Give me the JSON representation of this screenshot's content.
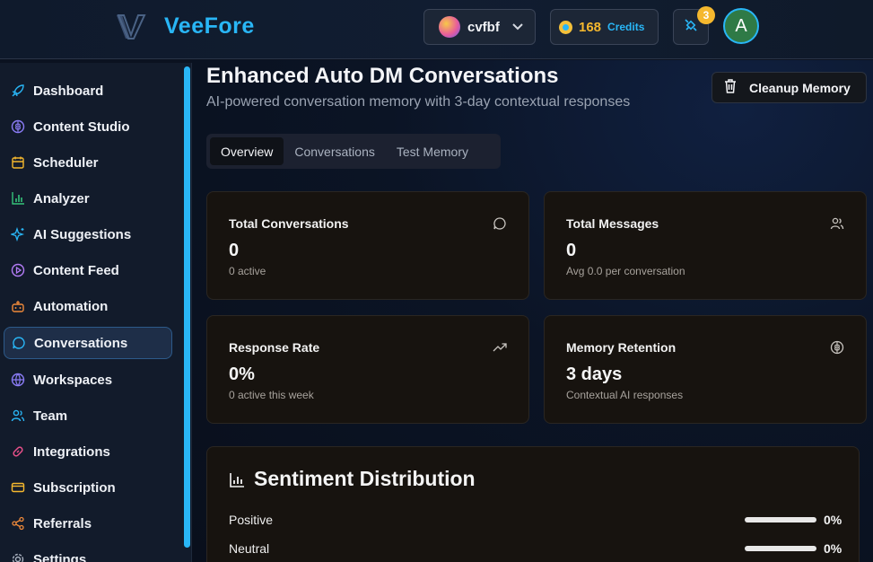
{
  "brand": {
    "name": "VeeFore",
    "accent": "#29b6f6"
  },
  "header": {
    "workspace_name": "cvfbf",
    "credits_value": "168",
    "credits_label": "Credits",
    "notification_count": "3",
    "user_initial": "A"
  },
  "sidebar": {
    "items": [
      {
        "label": "Dashboard",
        "icon": "rocket-icon",
        "color": "#29b6f6"
      },
      {
        "label": "Content Studio",
        "icon": "brain-icon",
        "color": "#8b7cf6"
      },
      {
        "label": "Scheduler",
        "icon": "calendar-icon",
        "color": "#f5b82e"
      },
      {
        "label": "Analyzer",
        "icon": "bar-chart-icon",
        "color": "#34c37a"
      },
      {
        "label": "AI Suggestions",
        "icon": "sparkles-icon",
        "color": "#29b6f6"
      },
      {
        "label": "Content Feed",
        "icon": "play-circle-icon",
        "color": "#b37cf6"
      },
      {
        "label": "Automation",
        "icon": "bot-icon",
        "color": "#f08a3a"
      },
      {
        "label": "Conversations",
        "icon": "message-circle-icon",
        "color": "#29b6f6",
        "active": true
      },
      {
        "label": "Workspaces",
        "icon": "globe-icon",
        "color": "#8b7cf6"
      },
      {
        "label": "Team",
        "icon": "users-icon",
        "color": "#29b6f6"
      },
      {
        "label": "Integrations",
        "icon": "link-icon",
        "color": "#e8508a"
      },
      {
        "label": "Subscription",
        "icon": "credit-card-icon",
        "color": "#f5b82e"
      },
      {
        "label": "Referrals",
        "icon": "share-icon",
        "color": "#f08a3a"
      },
      {
        "label": "Settings",
        "icon": "gear-icon",
        "color": "#aab2c0"
      }
    ]
  },
  "page": {
    "title": "Enhanced Auto DM Conversations",
    "subtitle": "AI-powered conversation memory with 3-day contextual responses",
    "cleanup_label": "Cleanup Memory",
    "tabs": [
      {
        "label": "Overview",
        "active": true
      },
      {
        "label": "Conversations"
      },
      {
        "label": "Test Memory"
      }
    ]
  },
  "stats": [
    {
      "title": "Total Conversations",
      "value": "0",
      "sub": "0 active",
      "icon": "message-circle-icon"
    },
    {
      "title": "Total Messages",
      "value": "0",
      "sub": "Avg 0.0 per conversation",
      "icon": "users-icon"
    },
    {
      "title": "Response Rate",
      "value": "0%",
      "sub": "0 active this week",
      "icon": "trending-up-icon"
    },
    {
      "title": "Memory Retention",
      "value": "3 days",
      "sub": "Contextual AI responses",
      "icon": "brain-icon"
    }
  ],
  "sentiment": {
    "title": "Sentiment Distribution",
    "rows": [
      {
        "label": "Positive",
        "percent_text": "0%",
        "fill": 0
      },
      {
        "label": "Neutral",
        "percent_text": "0%",
        "fill": 0
      }
    ]
  }
}
